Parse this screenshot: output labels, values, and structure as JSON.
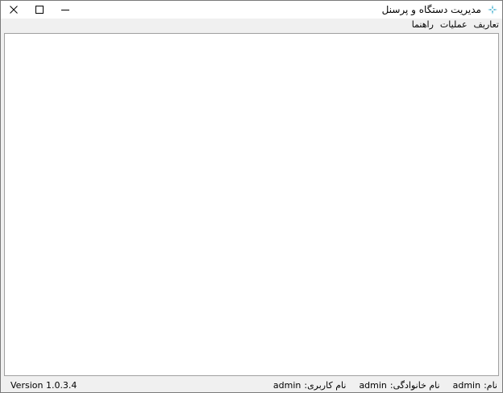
{
  "window": {
    "title": "مدیریت دستگاه و پرسنل",
    "icons": {
      "app": "app-icon",
      "close": "close-icon",
      "maximize": "maximize-icon",
      "minimize": "minimize-icon"
    }
  },
  "menu": [
    {
      "label": "تعاریف"
    },
    {
      "label": "عملیات"
    },
    {
      "label": "راهنما"
    }
  ],
  "status": {
    "version": "Version 1.0.3.4",
    "first_name_label": "نام:",
    "first_name_value": "admin",
    "last_name_label": "نام خانوادگی:",
    "last_name_value": "admin",
    "username_label": "نام کاربری:",
    "username_value": "admin"
  },
  "colors": {
    "accent": "#2aa6c9",
    "window_bg": "#f0f0f0",
    "client_bg": "#ffffff"
  }
}
